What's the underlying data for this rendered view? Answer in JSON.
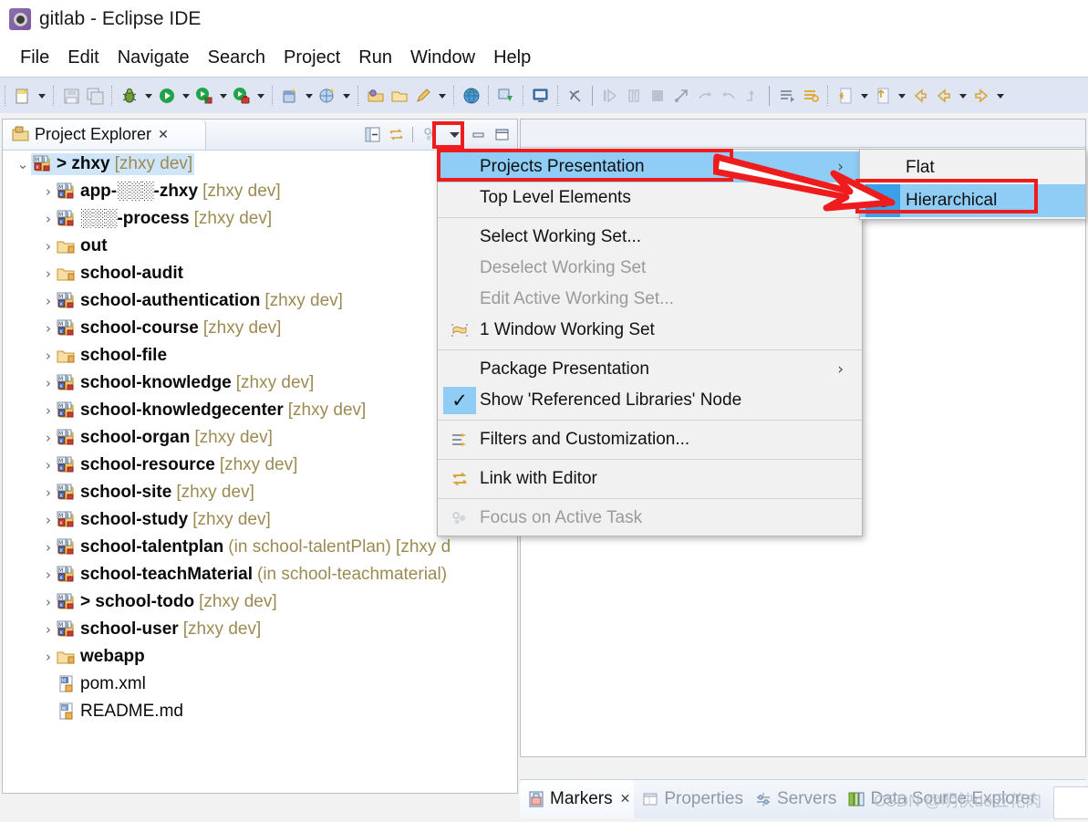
{
  "window": {
    "title": "gitlab - Eclipse IDE",
    "icon": "eclipse-gear-icon"
  },
  "menubar": {
    "items": [
      {
        "label": "File",
        "name": "menu-file"
      },
      {
        "label": "Edit",
        "name": "menu-edit"
      },
      {
        "label": "Navigate",
        "name": "menu-navigate"
      },
      {
        "label": "Search",
        "name": "menu-search"
      },
      {
        "label": "Project",
        "name": "menu-project"
      },
      {
        "label": "Run",
        "name": "menu-run"
      },
      {
        "label": "Window",
        "name": "menu-window"
      },
      {
        "label": "Help",
        "name": "menu-help"
      }
    ]
  },
  "toolbar": {
    "icons": [
      "new-wizard-icon",
      "save-icon",
      "save-all-icon",
      "debug-icon",
      "run-icon",
      "run-last-tool-icon",
      "coverage-icon",
      "new-java-project-icon",
      "new-package-icon",
      "open-type-icon",
      "open-task-icon",
      "edit-icon",
      "external-tools-icon",
      "remote-java-app-icon",
      "terminal-icon",
      "skip-breakpoints-icon",
      "step-into-icon",
      "pause-icon",
      "stop-icon",
      "disconnect-icon",
      "step-over-icon",
      "step-return-icon",
      "drop-to-frame-icon",
      "next-annotation-icon",
      "previous-annotation-icon",
      "last-edit-location-icon",
      "back-icon",
      "forward-icon",
      "previous-edit-icon",
      "next-edit-icon"
    ]
  },
  "explorer": {
    "tab": {
      "label": "Project Explorer",
      "icon": "project-explorer-icon",
      "close": "✕"
    },
    "view_tools": [
      {
        "name": "collapse-all-icon"
      },
      {
        "name": "link-with-editor-icon"
      },
      {
        "name": "focus-on-active-task-icon"
      },
      {
        "name": "view-menu-icon"
      },
      {
        "name": "minimize-icon"
      },
      {
        "name": "maximize-icon"
      }
    ],
    "tree": [
      {
        "indent": 0,
        "twisty": "v",
        "icon": "maven-project-icon-red",
        "name": "> zhxy",
        "suffix": "[zhxy dev]",
        "selected": true
      },
      {
        "indent": 1,
        "twisty": ">",
        "icon": "maven-project-icon",
        "name": "app-░░░-zhxy",
        "suffix": "[zhxy dev]",
        "blurred": true
      },
      {
        "indent": 1,
        "twisty": ">",
        "icon": "maven-project-icon",
        "name": "░░░-process",
        "suffix": "[zhxy dev]",
        "blurred": true
      },
      {
        "indent": 1,
        "twisty": ">",
        "icon": "folder-icon",
        "name": "out",
        "suffix": ""
      },
      {
        "indent": 1,
        "twisty": ">",
        "icon": "folder-icon",
        "name": "school-audit",
        "suffix": ""
      },
      {
        "indent": 1,
        "twisty": ">",
        "icon": "maven-project-icon",
        "name": "school-authentication",
        "suffix": "[zhxy dev]"
      },
      {
        "indent": 1,
        "twisty": ">",
        "icon": "maven-project-icon",
        "name": "school-course",
        "suffix": "[zhxy dev]"
      },
      {
        "indent": 1,
        "twisty": ">",
        "icon": "folder-icon",
        "name": "school-file",
        "suffix": ""
      },
      {
        "indent": 1,
        "twisty": ">",
        "icon": "maven-project-icon",
        "name": "school-knowledge",
        "suffix": "[zhxy dev]"
      },
      {
        "indent": 1,
        "twisty": ">",
        "icon": "maven-project-icon",
        "name": "school-knowledgecenter",
        "suffix": "[zhxy dev]"
      },
      {
        "indent": 1,
        "twisty": ">",
        "icon": "maven-project-icon",
        "name": "school-organ",
        "suffix": "[zhxy dev]"
      },
      {
        "indent": 1,
        "twisty": ">",
        "icon": "maven-project-icon",
        "name": "school-resource",
        "suffix": "[zhxy dev]"
      },
      {
        "indent": 1,
        "twisty": ">",
        "icon": "maven-project-icon",
        "name": "school-site",
        "suffix": "[zhxy dev]"
      },
      {
        "indent": 1,
        "twisty": ">",
        "icon": "maven-project-icon-red",
        "name": "school-study",
        "suffix": "[zhxy dev]"
      },
      {
        "indent": 1,
        "twisty": ">",
        "icon": "maven-project-icon",
        "name": "school-talentplan",
        "suffix": "(in school-talentPlan) [zhxy d"
      },
      {
        "indent": 1,
        "twisty": ">",
        "icon": "maven-project-icon",
        "name": "school-teachMaterial",
        "suffix": "(in school-teachmaterial)"
      },
      {
        "indent": 1,
        "twisty": ">",
        "icon": "maven-project-icon",
        "name": "> school-todo",
        "suffix": "[zhxy dev]"
      },
      {
        "indent": 1,
        "twisty": ">",
        "icon": "maven-project-icon",
        "name": "school-user",
        "suffix": "[zhxy dev]"
      },
      {
        "indent": 1,
        "twisty": ">",
        "icon": "folder-icon",
        "name": "webapp",
        "suffix": ""
      },
      {
        "indent": 1,
        "twisty": "",
        "icon": "xml-file-icon",
        "name": "pom.xml",
        "suffix": "",
        "plain": true
      },
      {
        "indent": 1,
        "twisty": "",
        "icon": "md-file-icon",
        "name": "README.md",
        "suffix": "",
        "plain": true
      }
    ]
  },
  "context_menu": {
    "items": [
      {
        "label": "Projects Presentation",
        "selected": true,
        "submenu": true,
        "arrow": "›",
        "icon": null,
        "disabled": false
      },
      {
        "label": "Top Level Elements",
        "selected": false,
        "submenu": true,
        "arrow": "›",
        "icon": null,
        "disabled": false
      },
      {
        "separator": true
      },
      {
        "label": "Select Working Set...",
        "selected": false,
        "submenu": false,
        "icon": null,
        "disabled": false
      },
      {
        "label": "Deselect Working Set",
        "selected": false,
        "submenu": false,
        "icon": null,
        "disabled": true
      },
      {
        "label": "Edit Active Working Set...",
        "selected": false,
        "submenu": false,
        "icon": null,
        "disabled": true
      },
      {
        "label": "1 Window Working Set",
        "selected": false,
        "submenu": false,
        "icon": "working-set-icon",
        "disabled": false
      },
      {
        "separator": true
      },
      {
        "label": "Package Presentation",
        "selected": false,
        "submenu": true,
        "arrow": "›",
        "icon": null,
        "disabled": false
      },
      {
        "label": "Show 'Referenced Libraries' Node",
        "selected": false,
        "submenu": false,
        "icon": "checkmark-icon",
        "checked": true,
        "disabled": false
      },
      {
        "separator": true
      },
      {
        "label": "Filters and Customization...",
        "selected": false,
        "submenu": false,
        "icon": "filters-icon",
        "disabled": false
      },
      {
        "separator": true
      },
      {
        "label": "Link with Editor",
        "selected": false,
        "submenu": false,
        "icon": "link-with-editor-icon",
        "disabled": false
      },
      {
        "separator": true
      },
      {
        "label": "Focus on Active Task",
        "selected": false,
        "submenu": false,
        "icon": "focus-task-icon",
        "disabled": true
      }
    ]
  },
  "submenu": {
    "title": "Projects Presentation",
    "items": [
      {
        "label": "Flat",
        "selected_radio": false,
        "highlighted": false
      },
      {
        "label": "Hierarchical",
        "selected_radio": true,
        "highlighted": true
      }
    ]
  },
  "bottom_views": {
    "tabs": [
      {
        "label": "Markers",
        "icon": "markers-icon",
        "active": true,
        "close": "✕"
      },
      {
        "label": "Properties",
        "icon": "properties-icon",
        "active": false
      },
      {
        "label": "Servers",
        "icon": "servers-icon",
        "active": false
      },
      {
        "label": "Data Source Explorer",
        "icon": "data-source-icon",
        "active": false
      }
    ]
  },
  "annotations": {
    "color": "#ee1c1c",
    "boxes": [
      "view-menu-dropdown",
      "projects-presentation-item",
      "hierarchical-item"
    ],
    "arrow": "arrow-from-projects-presentation-to-hierarchical"
  },
  "watermark": {
    "text": "CSDN @明快de五花肉"
  }
}
